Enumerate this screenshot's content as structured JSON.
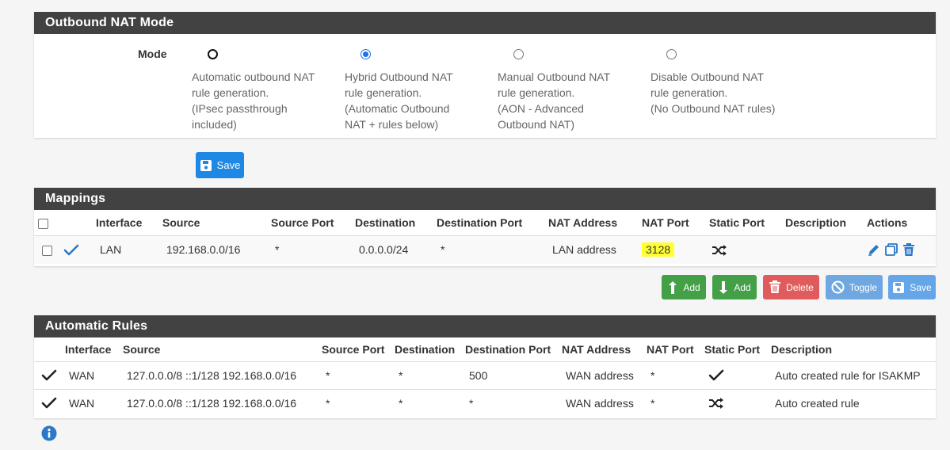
{
  "mode_panel": {
    "title": "Outbound NAT Mode",
    "mode_label": "Mode",
    "options": [
      {
        "text": "Automatic outbound NAT\nrule generation.\n(IPsec passthrough\nincluded)",
        "selected": false
      },
      {
        "text": "Hybrid Outbound NAT\nrule generation.\n(Automatic Outbound\nNAT + rules below)",
        "selected": true
      },
      {
        "text": "Manual Outbound NAT\nrule generation.\n(AON - Advanced\nOutbound NAT)",
        "selected": false
      },
      {
        "text": "Disable Outbound NAT\nrule generation.\n(No Outbound NAT rules)",
        "selected": false
      }
    ],
    "save_label": "Save"
  },
  "mappings": {
    "title": "Mappings",
    "columns": [
      "Interface",
      "Source",
      "Source Port",
      "Destination",
      "Destination Port",
      "NAT Address",
      "NAT Port",
      "Static Port",
      "Description",
      "Actions"
    ],
    "rows": [
      {
        "interface": "LAN",
        "source": "192.168.0.0/16",
        "source_port": "*",
        "destination": "0.0.0.0/24",
        "destination_port": "*",
        "nat_address": "LAN address",
        "nat_port": "3128",
        "static_port_icon": "shuffle-icon",
        "description": ""
      }
    ],
    "buttons": {
      "add_top": "Add",
      "add_bottom": "Add",
      "delete": "Delete",
      "toggle": "Toggle",
      "save": "Save"
    }
  },
  "automatic_rules": {
    "title": "Automatic Rules",
    "columns": [
      "Interface",
      "Source",
      "Source Port",
      "Destination",
      "Destination Port",
      "NAT Address",
      "NAT Port",
      "Static Port",
      "Description"
    ],
    "rows": [
      {
        "interface": "WAN",
        "source": "127.0.0.0/8 ::1/128 192.168.0.0/16",
        "source_port": "*",
        "destination": "*",
        "destination_port": "500",
        "nat_address": "WAN address",
        "nat_port": "*",
        "static_port_icon": "check-icon",
        "description": "Auto created rule for ISAKMP"
      },
      {
        "interface": "WAN",
        "source": "127.0.0.0/8 ::1/128 192.168.0.0/16",
        "source_port": "*",
        "destination": "*",
        "destination_port": "*",
        "nat_address": "WAN address",
        "nat_port": "*",
        "static_port_icon": "shuffle-icon",
        "description": "Auto created rule"
      }
    ]
  },
  "colors": {
    "panel_heading": "#424242",
    "primary": "#1e88e5",
    "success": "#43a047",
    "danger": "#e05c5c",
    "highlight": "#ffff33"
  }
}
